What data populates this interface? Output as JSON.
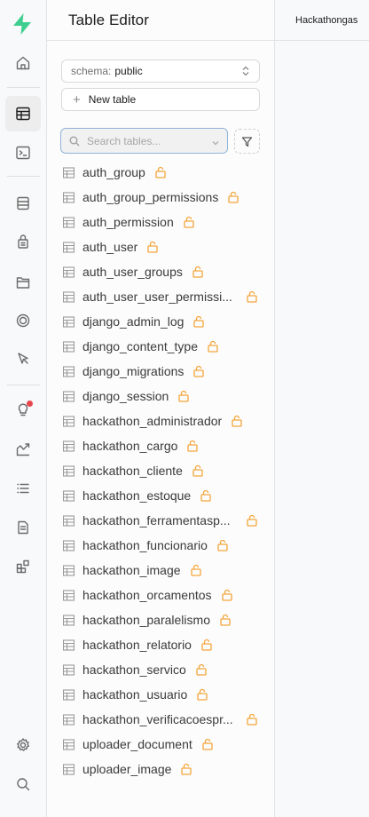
{
  "rail": {
    "logo_color": "#3ecf8e",
    "items": [
      {
        "icon": "home-icon"
      },
      {
        "icon": "table-editor-icon",
        "active": true
      },
      {
        "icon": "sql-editor-icon"
      },
      {
        "icon": "database-icon"
      },
      {
        "icon": "auth-icon"
      },
      {
        "icon": "storage-icon"
      },
      {
        "icon": "realtime-icon"
      },
      {
        "icon": "edge-functions-icon"
      },
      {
        "icon": "advisors-icon",
        "notification": true
      },
      {
        "icon": "reports-icon"
      },
      {
        "icon": "logs-icon"
      },
      {
        "icon": "api-docs-icon"
      },
      {
        "icon": "integrations-icon"
      },
      {
        "icon": "settings-icon"
      },
      {
        "icon": "search-icon"
      }
    ]
  },
  "panel": {
    "title": "Table Editor",
    "schema_label": "schema:",
    "schema_value": "public",
    "new_table_label": "New table",
    "search_placeholder": "Search tables...",
    "tables": [
      "auth_group",
      "auth_group_permissions",
      "auth_permission",
      "auth_user",
      "auth_user_groups",
      "auth_user_user_permissi...",
      "django_admin_log",
      "django_content_type",
      "django_migrations",
      "django_session",
      "hackathon_administrador",
      "hackathon_cargo",
      "hackathon_cliente",
      "hackathon_estoque",
      "hackathon_ferramentasp...",
      "hackathon_funcionario",
      "hackathon_image",
      "hackathon_orcamentos",
      "hackathon_paralelismo",
      "hackathon_relatorio",
      "hackathon_servico",
      "hackathon_usuario",
      "hackathon_verificacoespr...",
      "uploader_document",
      "uploader_image"
    ],
    "lock_color": "#f3a53a"
  },
  "main": {
    "project_name": "Hackathongas"
  }
}
